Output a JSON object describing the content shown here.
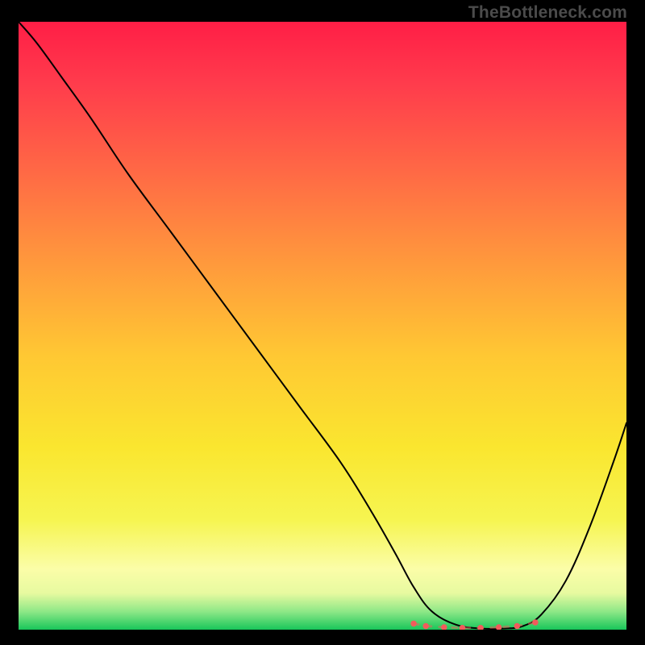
{
  "watermark": "TheBottleneck.com",
  "chart_data": {
    "type": "line",
    "title": "",
    "xlabel": "",
    "ylabel": "",
    "xlim": [
      0,
      100
    ],
    "ylim": [
      0,
      100
    ],
    "grid": false,
    "legend": false,
    "background": {
      "type": "vertical-gradient",
      "stops": [
        {
          "t": 0.0,
          "color": "#ff1e46"
        },
        {
          "t": 0.1,
          "color": "#ff3b4c"
        },
        {
          "t": 0.25,
          "color": "#ff6a45"
        },
        {
          "t": 0.4,
          "color": "#ff9a3c"
        },
        {
          "t": 0.55,
          "color": "#ffc833"
        },
        {
          "t": 0.7,
          "color": "#fae62f"
        },
        {
          "t": 0.82,
          "color": "#f6f551"
        },
        {
          "t": 0.9,
          "color": "#fbfda8"
        },
        {
          "t": 0.94,
          "color": "#e7faa0"
        },
        {
          "t": 0.97,
          "color": "#8fe887"
        },
        {
          "t": 1.0,
          "color": "#18c65a"
        }
      ]
    },
    "series": [
      {
        "name": "curve",
        "color": "#000000",
        "width": 2,
        "x": [
          0,
          3,
          7,
          12,
          18,
          25,
          32,
          39,
          46,
          53,
          58,
          62,
          65,
          68,
          72,
          76,
          80,
          83,
          86,
          90,
          94,
          98,
          100
        ],
        "y": [
          100,
          96.5,
          91,
          84,
          75,
          65.5,
          56,
          46.5,
          37,
          27.5,
          19.5,
          12.5,
          7,
          3,
          0.8,
          0.2,
          0.2,
          0.6,
          2.5,
          8,
          17,
          28,
          34
        ]
      },
      {
        "name": "valley-marker",
        "color": "#f25b5b",
        "width": 6,
        "style": "dotted",
        "x": [
          65,
          67,
          70,
          73,
          76,
          79,
          82,
          85
        ],
        "y": [
          1.0,
          0.6,
          0.4,
          0.3,
          0.3,
          0.4,
          0.6,
          1.2
        ]
      }
    ]
  }
}
